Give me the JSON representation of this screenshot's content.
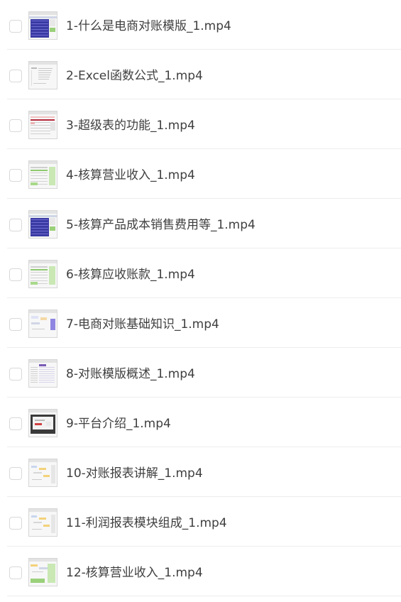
{
  "files": [
    {
      "name": "1-什么是电商对账模版_1.mp4",
      "thumb": "spreadsheet-blue"
    },
    {
      "name": "2-Excel函数公式_1.mp4",
      "thumb": "spreadsheet-text"
    },
    {
      "name": "3-超级表的功能_1.mp4",
      "thumb": "spreadsheet-red"
    },
    {
      "name": "4-核算营业收入_1.mp4",
      "thumb": "spreadsheet-green"
    },
    {
      "name": "5-核算产品成本销售费用等_1.mp4",
      "thumb": "spreadsheet-blue"
    },
    {
      "name": "6-核算应收账款_1.mp4",
      "thumb": "spreadsheet-green"
    },
    {
      "name": "7-电商对账基础知识_1.mp4",
      "thumb": "diagram-purple"
    },
    {
      "name": "8-对账模版概述_1.mp4",
      "thumb": "spreadsheet-list"
    },
    {
      "name": "9-平台介绍_1.mp4",
      "thumb": "screen-dark"
    },
    {
      "name": "10-对账报表讲解_1.mp4",
      "thumb": "diagram-yellow"
    },
    {
      "name": "11-利润报表模块组成_1.mp4",
      "thumb": "diagram-yellow"
    },
    {
      "name": "12-核算营业收入_1.mp4",
      "thumb": "spreadsheet-green-diagram"
    }
  ],
  "colors": {
    "text": "#3f3f3f",
    "checkbox_border": "#d9d9d9",
    "divider": "#ededed"
  }
}
